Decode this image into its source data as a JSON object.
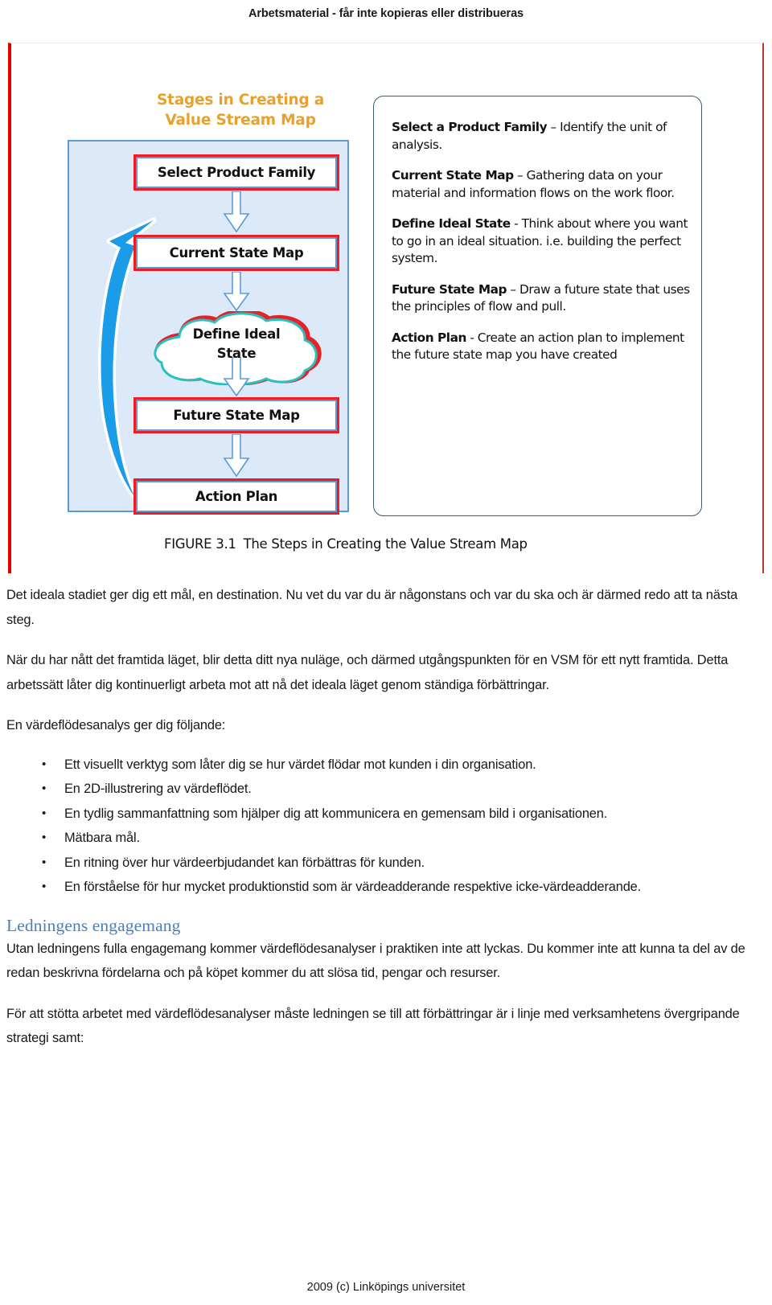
{
  "header": {
    "watermark": "Arbetsmaterial - får inte kopieras eller distribueras"
  },
  "figure": {
    "flow_title_line1": "Stages in Creating a",
    "flow_title_line2": "Value Stream Map",
    "steps": [
      {
        "label": "Select Product Family",
        "shape": "box"
      },
      {
        "label": "Current State Map",
        "shape": "box"
      },
      {
        "label_line1": "Define Ideal",
        "label_line2": "State",
        "shape": "cloud"
      },
      {
        "label": "Future State Map",
        "shape": "box"
      },
      {
        "label": "Action Plan",
        "shape": "box"
      }
    ],
    "descriptions": [
      {
        "term": "Select a Product Family",
        "text": " – Identify the unit of analysis."
      },
      {
        "term": "Current State Map",
        "text": " – Gathering data on your material and information flows on the work floor."
      },
      {
        "term": "Define Ideal State",
        "text": " - Think about where you want to go in an ideal situation. i.e. building the perfect system."
      },
      {
        "term": "Future State Map",
        "text": " – Draw a future state that uses the principles of flow and pull."
      },
      {
        "term": "Action Plan",
        "text": " - Create an action plan to implement the future state map you have created"
      }
    ],
    "caption_label": "FIGURE 3.1",
    "caption_text": "The Steps in Creating the Value Stream Map",
    "colors": {
      "title": "#e8a22b",
      "panel_fill": "#dbe9f8",
      "panel_border": "#5b9bd5",
      "box_border": "#ee1c25",
      "arrow_blue": "#1a9ce8",
      "cloud_red": "#e8202a",
      "cloud_teal": "#2bbfbf",
      "text_panel_border": "#37606b",
      "rule_red": "#e00000"
    }
  },
  "body": {
    "p1": "Det ideala stadiet ger dig ett mål, en destination. Nu vet du var du är någonstans och var du ska och är därmed redo att ta nästa steg.",
    "p2": "När du har nått det framtida läget, blir detta ditt nya nuläge, och därmed utgångspunkten för en VSM för ett nytt framtida. Detta arbetssätt låter dig kontinuerligt arbeta mot att nå det ideala läget genom ständiga förbättringar.",
    "p3": "En värdeflödesanalys ger dig följande:",
    "bullets": [
      "Ett visuellt verktyg som låter dig se hur värdet flödar mot kunden i din organisation.",
      "En 2D-illustrering av värdeflödet.",
      "En tydlig sammanfattning som hjälper dig att kommunicera en gemensam bild i organisationen.",
      "Mätbara mål.",
      "En ritning över hur värdeerbjudandet kan förbättras för kunden.",
      "En förståelse för hur mycket produktionstid som är värdeadderande respektive icke-värdeadderande."
    ],
    "heading": "Ledningens engagemang",
    "p4": "Utan ledningens fulla engagemang kommer värdeflödesanalyser i praktiken inte att lyckas. Du kommer inte att kunna ta del av de redan beskrivna fördelarna och på köpet kommer du att slösa tid, pengar och resurser.",
    "p5": "För att stötta arbetet med värdeflödesanalyser måste ledningen se till att förbättringar är i linje med verksamhetens övergripande strategi samt:"
  },
  "footer": {
    "copyright": "2009 (c) Linköpings universitet"
  }
}
